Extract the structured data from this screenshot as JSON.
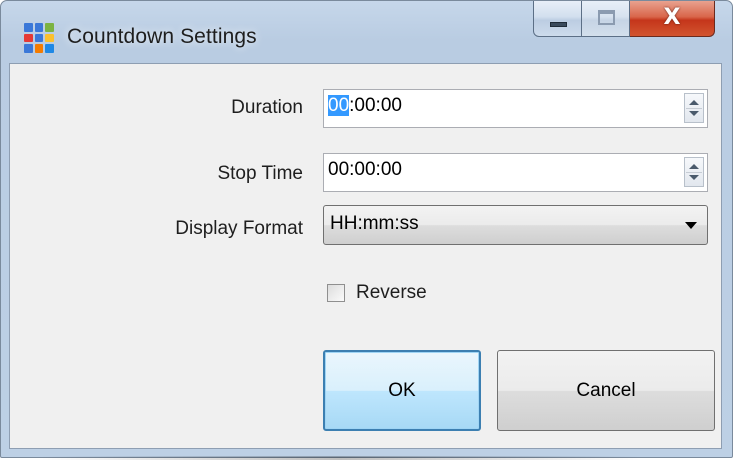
{
  "window": {
    "title": "Countdown Settings",
    "icon": "grid-app-icon",
    "icon_colors": [
      "#3b78d8",
      "#3b78d8",
      "#7cb342",
      "#e53935",
      "#3b78d8",
      "#fbc02d",
      "#3b78d8",
      "#f57c00",
      "#1e88e5"
    ],
    "caption_buttons": {
      "minimize": "minimize-icon",
      "maximize": "maximize-icon",
      "close": "X"
    }
  },
  "form": {
    "duration": {
      "label": "Duration",
      "value_selected": "00",
      "value_rest": ":00:00"
    },
    "stop_time": {
      "label": "Stop Time",
      "value": "00:00:00"
    },
    "display_format": {
      "label": "Display Format",
      "value": "HH:mm:ss"
    },
    "reverse": {
      "label": "Reverse",
      "checked": false
    }
  },
  "buttons": {
    "ok": "OK",
    "cancel": "Cancel"
  },
  "colors": {
    "selection": "#3399ff",
    "close_button": "#c5361b",
    "default_button_border": "#3c7fb1"
  }
}
